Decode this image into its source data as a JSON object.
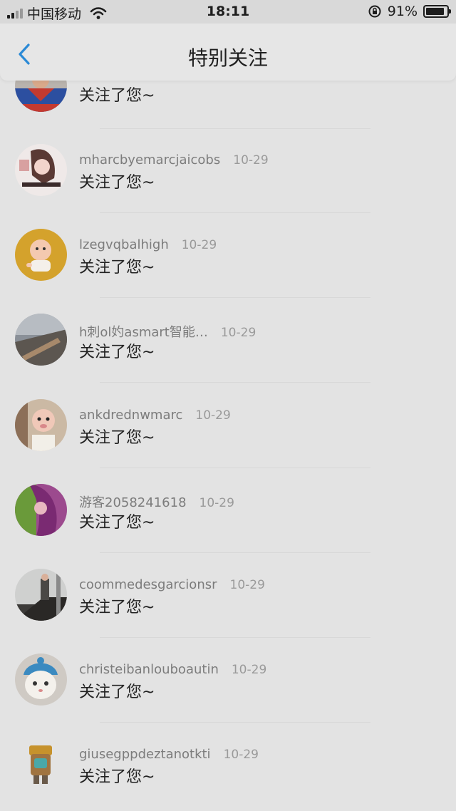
{
  "status_bar": {
    "carrier": "中国移动",
    "time": "18:11",
    "battery": "91%",
    "battery_level": 0.91
  },
  "nav": {
    "back_icon": "chevron-left-icon",
    "title": "特别关注",
    "accent_color": "#2b8ad6"
  },
  "notifications": [
    {
      "username": "",
      "date": "",
      "message": "关注了您~",
      "avatar": "superman-avatar"
    },
    {
      "username": "mharcbyemarcjaicobs",
      "date": "10-29",
      "message": "关注了您~",
      "avatar": "girl-sketch-avatar"
    },
    {
      "username": "lzegvqbalhigh",
      "date": "10-29",
      "message": "关注了您~",
      "avatar": "cartoon-baby-avatar"
    },
    {
      "username": "h刺ol妁asmart智能…",
      "date": "10-29",
      "message": "关注了您~",
      "avatar": "city-aerial-avatar"
    },
    {
      "username": "ankdrednwmarc",
      "date": "10-29",
      "message": "关注了您~",
      "avatar": "baby-face-avatar"
    },
    {
      "username": "游客2058241618",
      "date": "10-29",
      "message": "关注了您~",
      "avatar": "purple-hair-avatar"
    },
    {
      "username": "coommedesgarcionsr",
      "date": "10-29",
      "message": "关注了您~",
      "avatar": "staircase-person-avatar"
    },
    {
      "username": "christeibanlouboautin",
      "date": "10-29",
      "message": "关注了您~",
      "avatar": "cat-hat-avatar"
    },
    {
      "username": "giusegppdeztanotkti",
      "date": "10-29",
      "message": "关注了您~",
      "avatar": "robot-avatar"
    }
  ]
}
